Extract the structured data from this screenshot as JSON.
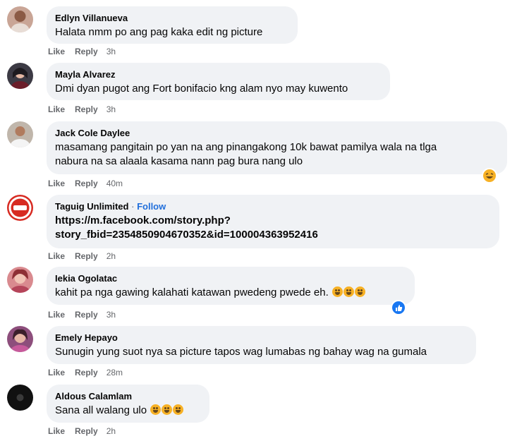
{
  "actions": {
    "like": "Like",
    "reply": "Reply"
  },
  "comments": [
    {
      "author": "Edlyn Villanueva",
      "text": "Halata nmm po ang pag kaka edit ng picture",
      "time": "3h",
      "avatar_color": "#c9a596"
    },
    {
      "author": "Mayla Alvarez",
      "text": "Dmi dyan pugot ang Fort bonifacio kng alam nyo may kuwento",
      "time": "3h",
      "avatar_color": "#3c3a44"
    },
    {
      "author": "Jack Cole Daylee",
      "text_lines": [
        "masamang pangitain po yan na ang pinangakong 10k bawat pamilya wala na tlga",
        "nabura na sa alaala kasama nann pag bura nang ulo"
      ],
      "time": "40m",
      "avatar_color": "#c0b6ab",
      "reaction": "haha-icon"
    },
    {
      "author": "Taguig Unlimited",
      "follow": "Follow",
      "separator": "·",
      "text_lines": [
        "https://m.facebook.com/story.php?",
        "story_fbid=2354850904670352&id=100004363952416"
      ],
      "time": "2h",
      "avatar_color": "#d72b22"
    },
    {
      "author": "Iekia Ogolatac",
      "text": "kahit pa nga gawing kalahati katawan pwedeng pwede eh.",
      "time": "3h",
      "avatar_color": "#d98a8f",
      "reaction": "like-icon"
    },
    {
      "author": "Emely Hepayo",
      "text": "Sunugin yung suot nya sa picture tapos wag lumabas ng bahay wag na gumala",
      "time": "28m",
      "avatar_color": "#8d4e7c"
    },
    {
      "author": "Aldous Calamlam",
      "text": "Sana all walang ulo",
      "time": "2h",
      "avatar_color": "#111111"
    }
  ],
  "colors": {
    "bubble": "#f0f2f5",
    "meta": "#65676b",
    "link": "#216fdb",
    "emoji": "#f7b125"
  }
}
